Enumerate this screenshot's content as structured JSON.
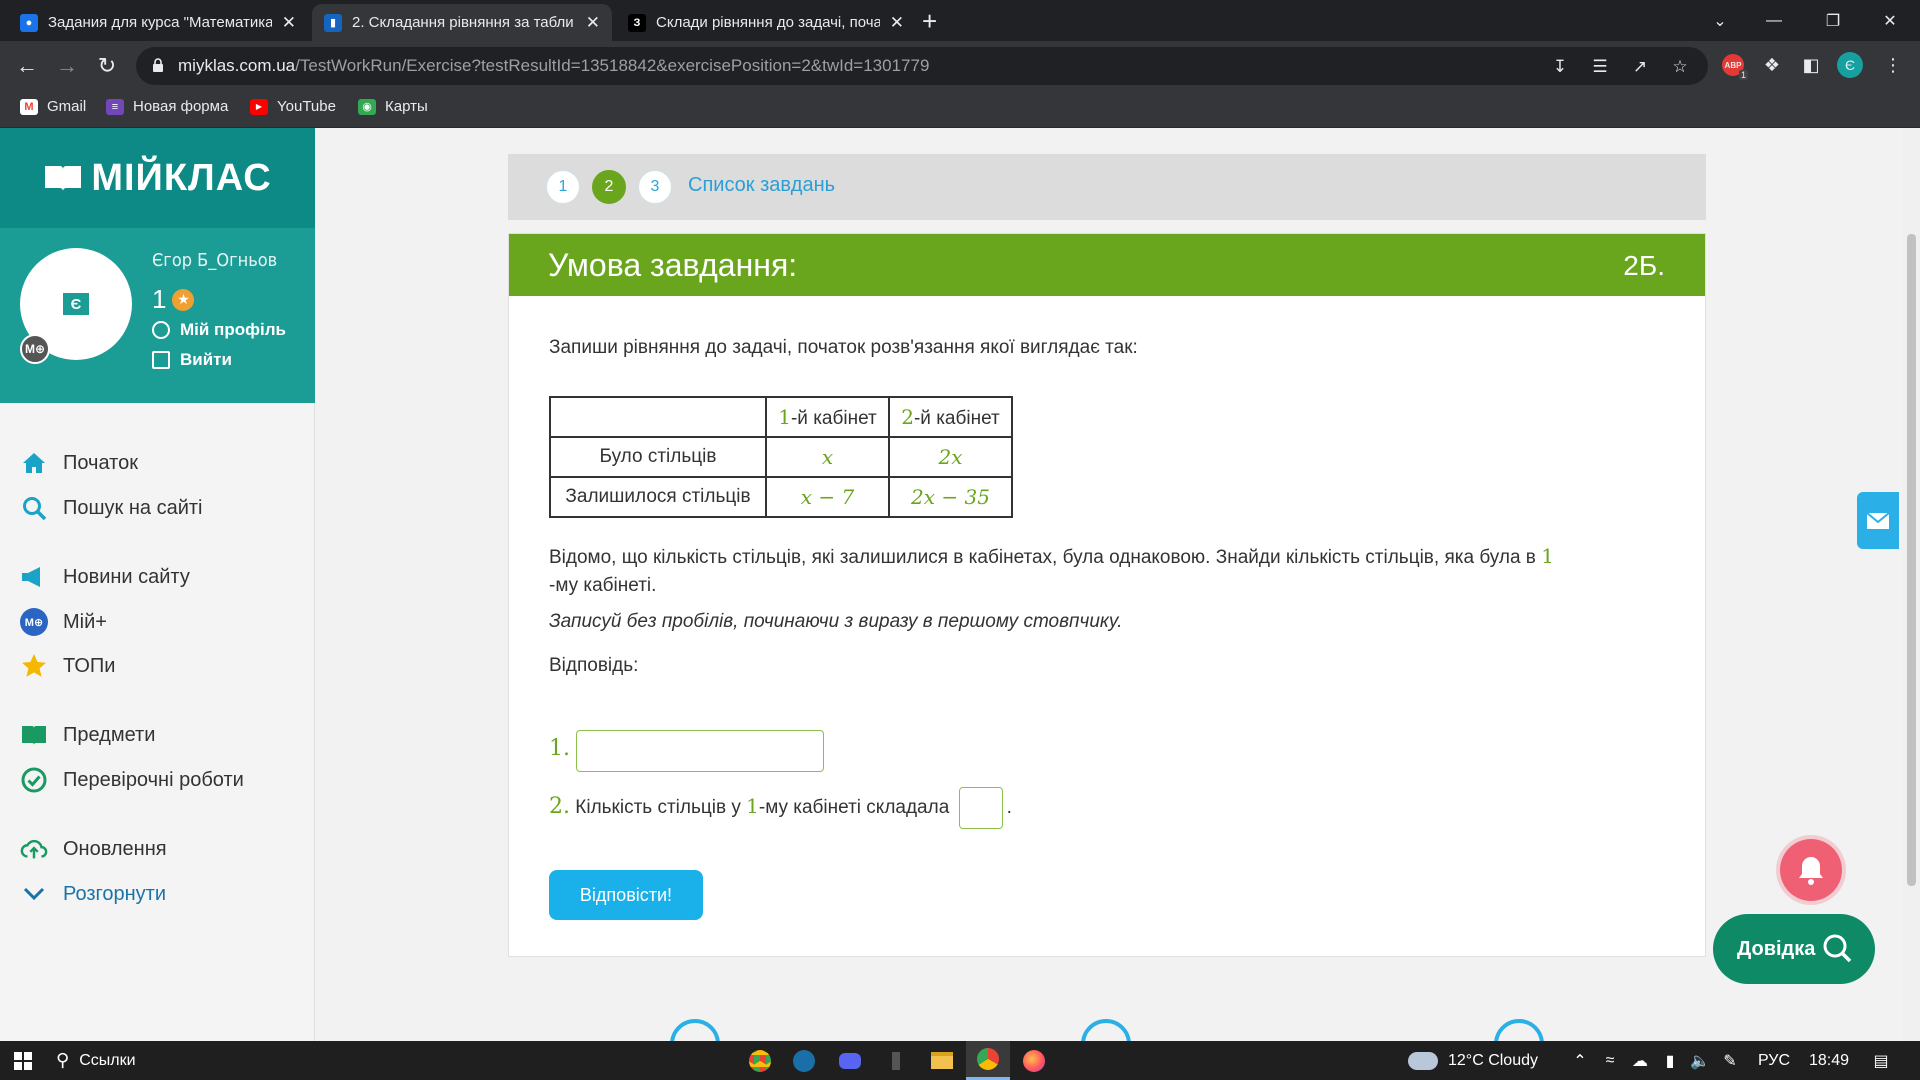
{
  "browser": {
    "tabs": [
      {
        "title": "Задания для курса \"Математика",
        "favicon": "classroom-icon"
      },
      {
        "title": "2. Складання рівняння за табли",
        "favicon": "miyklas-icon"
      },
      {
        "title": "Склади рівняння до задачі, поча",
        "favicon": "z-icon",
        "favicon_text": "З"
      }
    ],
    "url_host": "miyklas.com.ua",
    "url_path": "/TestWorkRun/Exercise?testResultId=13518842&exercisePosition=2&twId=1301779",
    "bookmarks": [
      {
        "label": "Gmail",
        "icon": "gmail-icon"
      },
      {
        "label": "Новая форма",
        "icon": "forms-icon"
      },
      {
        "label": "YouTube",
        "icon": "youtube-icon"
      },
      {
        "label": "Карты",
        "icon": "maps-icon"
      }
    ],
    "profile_letter": "Є",
    "ext_badge": "1",
    "abp_label": "ABP"
  },
  "site": {
    "logo": "МІЙКЛАС",
    "user": {
      "name": "Єгор Б_Огньов",
      "points": "1",
      "avatar_letter": "Є",
      "badge": "М⊕",
      "profile_link": "Мій профіль",
      "logout_link": "Вийти"
    },
    "menu": [
      {
        "label": "Початок",
        "icon": "home-icon"
      },
      {
        "label": "Пошук на сайті",
        "icon": "search-icon"
      },
      {
        "label": "Новини сайту",
        "icon": "news-icon"
      },
      {
        "label": "Мій+",
        "icon": "my-plus-icon",
        "icon_text": "М⊕"
      },
      {
        "label": "ТОПи",
        "icon": "star-icon"
      },
      {
        "label": "Предмети",
        "icon": "books-icon"
      },
      {
        "label": "Перевірочні роботи",
        "icon": "check-circle-icon"
      },
      {
        "label": "Оновлення",
        "icon": "cloud-upload-icon"
      },
      {
        "label": "Розгорнути",
        "icon": "chevron-down-icon"
      }
    ],
    "steps": [
      "1",
      "2",
      "3"
    ],
    "active_step": "2",
    "task_list": "Список завдань",
    "help_label": "Довідка"
  },
  "task": {
    "heading": "Умова завдання:",
    "points": "2Б.",
    "intro": "Запиши рівняння до задачі, початок розв'язання якої виглядає так:",
    "table": {
      "headers": [
        {
          "num": "",
          "text": ""
        },
        {
          "num": "1",
          "text": "-й кабінет"
        },
        {
          "num": "2",
          "text": "-й кабінет"
        }
      ],
      "rows": [
        {
          "label": "Було стільців",
          "c1": "x",
          "c2": "2x"
        },
        {
          "label": "Залишилося стільців",
          "c1": "x − 7",
          "c2": "2x − 35"
        }
      ]
    },
    "condition_a": "Відомо, що кількість стільців, які залишилися в кабінетах, була однаковою. Знайди кількість стільців, яка була в ",
    "condition_num": "1",
    "condition_b": "-му кабінеті.",
    "hint": "Записуй без пробілів, починаючи з виразу в першому стовпчику.",
    "answer_label": "Відповідь:",
    "q1_num": "1.",
    "q1_value": "",
    "q2_num": "2.",
    "q2_text_a": "Кількість стільців у ",
    "q2_text_num": "1",
    "q2_text_b": "-му кабінеті складала",
    "q2_end": ".",
    "q2_value": "",
    "submit": "Відповісти!"
  },
  "taskbar": {
    "search": "Ссылки",
    "weather": "12°C  Cloudy",
    "lang": "РУС",
    "time": "18:49"
  }
}
